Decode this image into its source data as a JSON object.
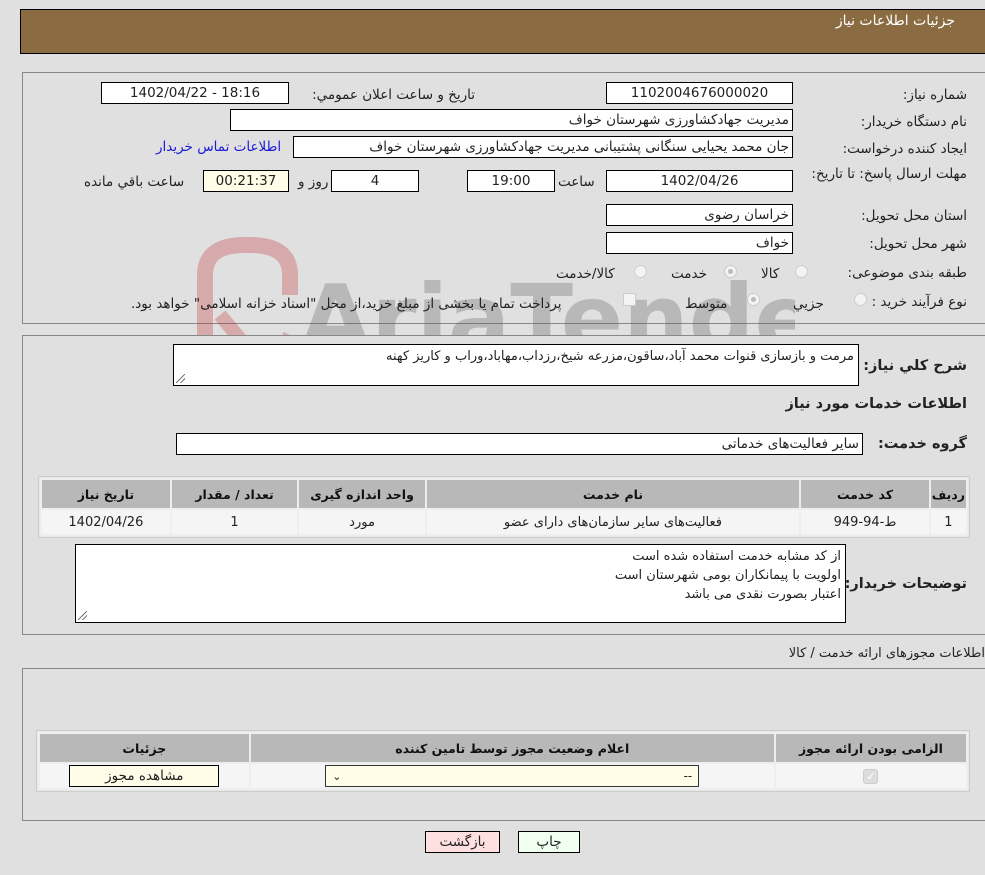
{
  "header": {
    "title": "جزئیات اطلاعات نیاز"
  },
  "fields": {
    "need_number_label": "شماره نیاز:",
    "need_number": "1102004676000020",
    "announce_label": "تاریخ و ساعت اعلان عمومي:",
    "announce_value": "1402/04/22 - 18:16",
    "buyer_org_label": "نام دستگاه خریدار:",
    "buyer_org": "مدیریت جهادکشاورزی شهرستان خواف",
    "creator_label": "ایجاد کننده درخواست:",
    "creator": "جان محمد یحیایی سنگانی پشتیبانی مدیریت جهادکشاورزی شهرستان خواف",
    "contact_link": "اطلاعات تماس خریدار",
    "deadline_label": "مهلت ارسال پاسخ: تا تاریخ:",
    "deadline_date": "1402/04/26",
    "time_label": "ساعت",
    "deadline_time": "19:00",
    "days_value": "4",
    "days_label": "روز و",
    "remaining_value": "00:21:37",
    "remaining_label": "ساعت باقي مانده",
    "province_label": "استان محل تحویل:",
    "province": "خراسان رضوی",
    "city_label": "شهر محل تحویل:",
    "city": "خواف",
    "category_label": "طبقه بندی موضوعی:",
    "category_options": [
      {
        "label": "کالا",
        "checked": false
      },
      {
        "label": "خدمت",
        "checked": true
      },
      {
        "label": "کالا/خدمت",
        "checked": false
      }
    ],
    "process_label": "نوع فرآیند خرید :",
    "process_options": [
      {
        "label": "جزيي",
        "checked": false
      },
      {
        "label": "متوسط",
        "checked": true
      }
    ],
    "treasury_note": "پرداخت تمام یا بخشی از مبلغ خرید،از محل \"اسناد خزانه اسلامی\" خواهد بود."
  },
  "description": {
    "label": "شرح کلي نیاز:",
    "value": "مرمت و بازسازی قنوات محمد آباد،ساقون،مزرعه شیخ،رزداب،مهاباد،وراب و کاریز کهنه"
  },
  "services": {
    "section_title": "اطلاعات خدمات مورد نیاز",
    "group_label": "گروه خدمت:",
    "group_value": "سایر فعالیت‌های خدماتی",
    "columns": [
      "ردیف",
      "کد خدمت",
      "نام خدمت",
      "واحد اندازه گیری",
      "تعداد / مقدار",
      "تاریخ نیاز"
    ],
    "rows": [
      [
        "1",
        "ط-94-949",
        "فعالیت‌های سایر سازمان‌های دارای عضو",
        "مورد",
        "1",
        "1402/04/26"
      ]
    ]
  },
  "buyer_notes": {
    "label": "توضیحات خریدار:",
    "lines": [
      "از کد مشابه خدمت استفاده شده است",
      "اولویت با پیمانکاران بومی شهرستان است",
      "اعتبار بصورت نقدی می باشد"
    ]
  },
  "permits": {
    "section_title": "اطلاعات مجوزهای ارائه خدمت / کالا",
    "columns": [
      "الزامی بودن ارائه مجوز",
      "اعلام وضعیت مجوز توسط تامین کننده",
      "جزئیات"
    ],
    "row": {
      "required_checked": true,
      "status_selected": "--",
      "details_button": "مشاهده مجوز"
    }
  },
  "buttons": {
    "print": "چاپ",
    "back": "بازگشت"
  },
  "colors": {
    "header_bg": "#8b6c42",
    "print_bg": "#f0fff0",
    "back_bg": "#ffe0e0",
    "link": "#1a1ad9"
  },
  "watermark": {
    "text": "AriaTender.neT"
  }
}
